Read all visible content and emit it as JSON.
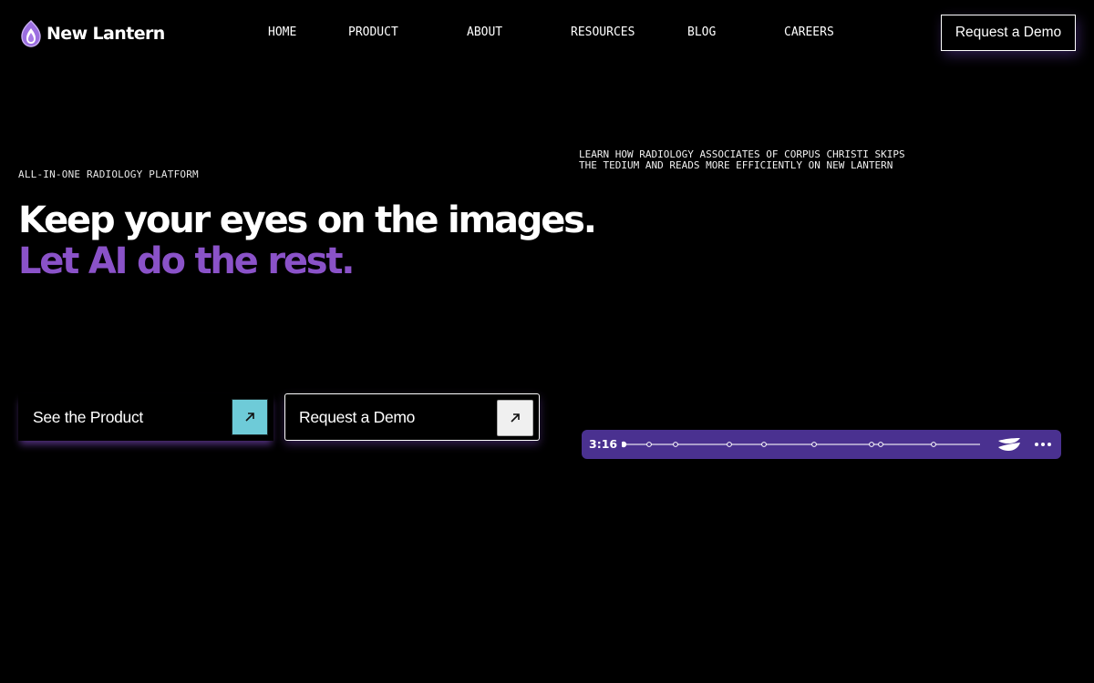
{
  "header": {
    "brand": "New Lantern",
    "nav": [
      "HOME",
      "PRODUCT",
      "ABOUT",
      "RESOURCES",
      "BLOG",
      "CAREERS"
    ],
    "cta_label": "Request a Demo"
  },
  "hero": {
    "eyebrow": "ALL-IN-ONE RADIOLOGY PLATFORM",
    "headline_line1": "Keep your eyes on the images.",
    "headline_line2": "Let AI do the rest.",
    "primary_button": "See the Product",
    "secondary_button": "Request a Demo"
  },
  "video": {
    "caption_line1": "LEARN HOW RADIOLOGY ASSOCIATES OF CORPUS CHRISTI SKIPS",
    "caption_line2": "THE TEDIUM AND READS MORE EFFICIENTLY ON NEW LANTERN",
    "duration": "3:16",
    "progress": 0
  },
  "colors": {
    "accent_purple": "#8a52c8",
    "player_bg": "#4a3190",
    "arrow_teal": "#6ecbd8"
  }
}
